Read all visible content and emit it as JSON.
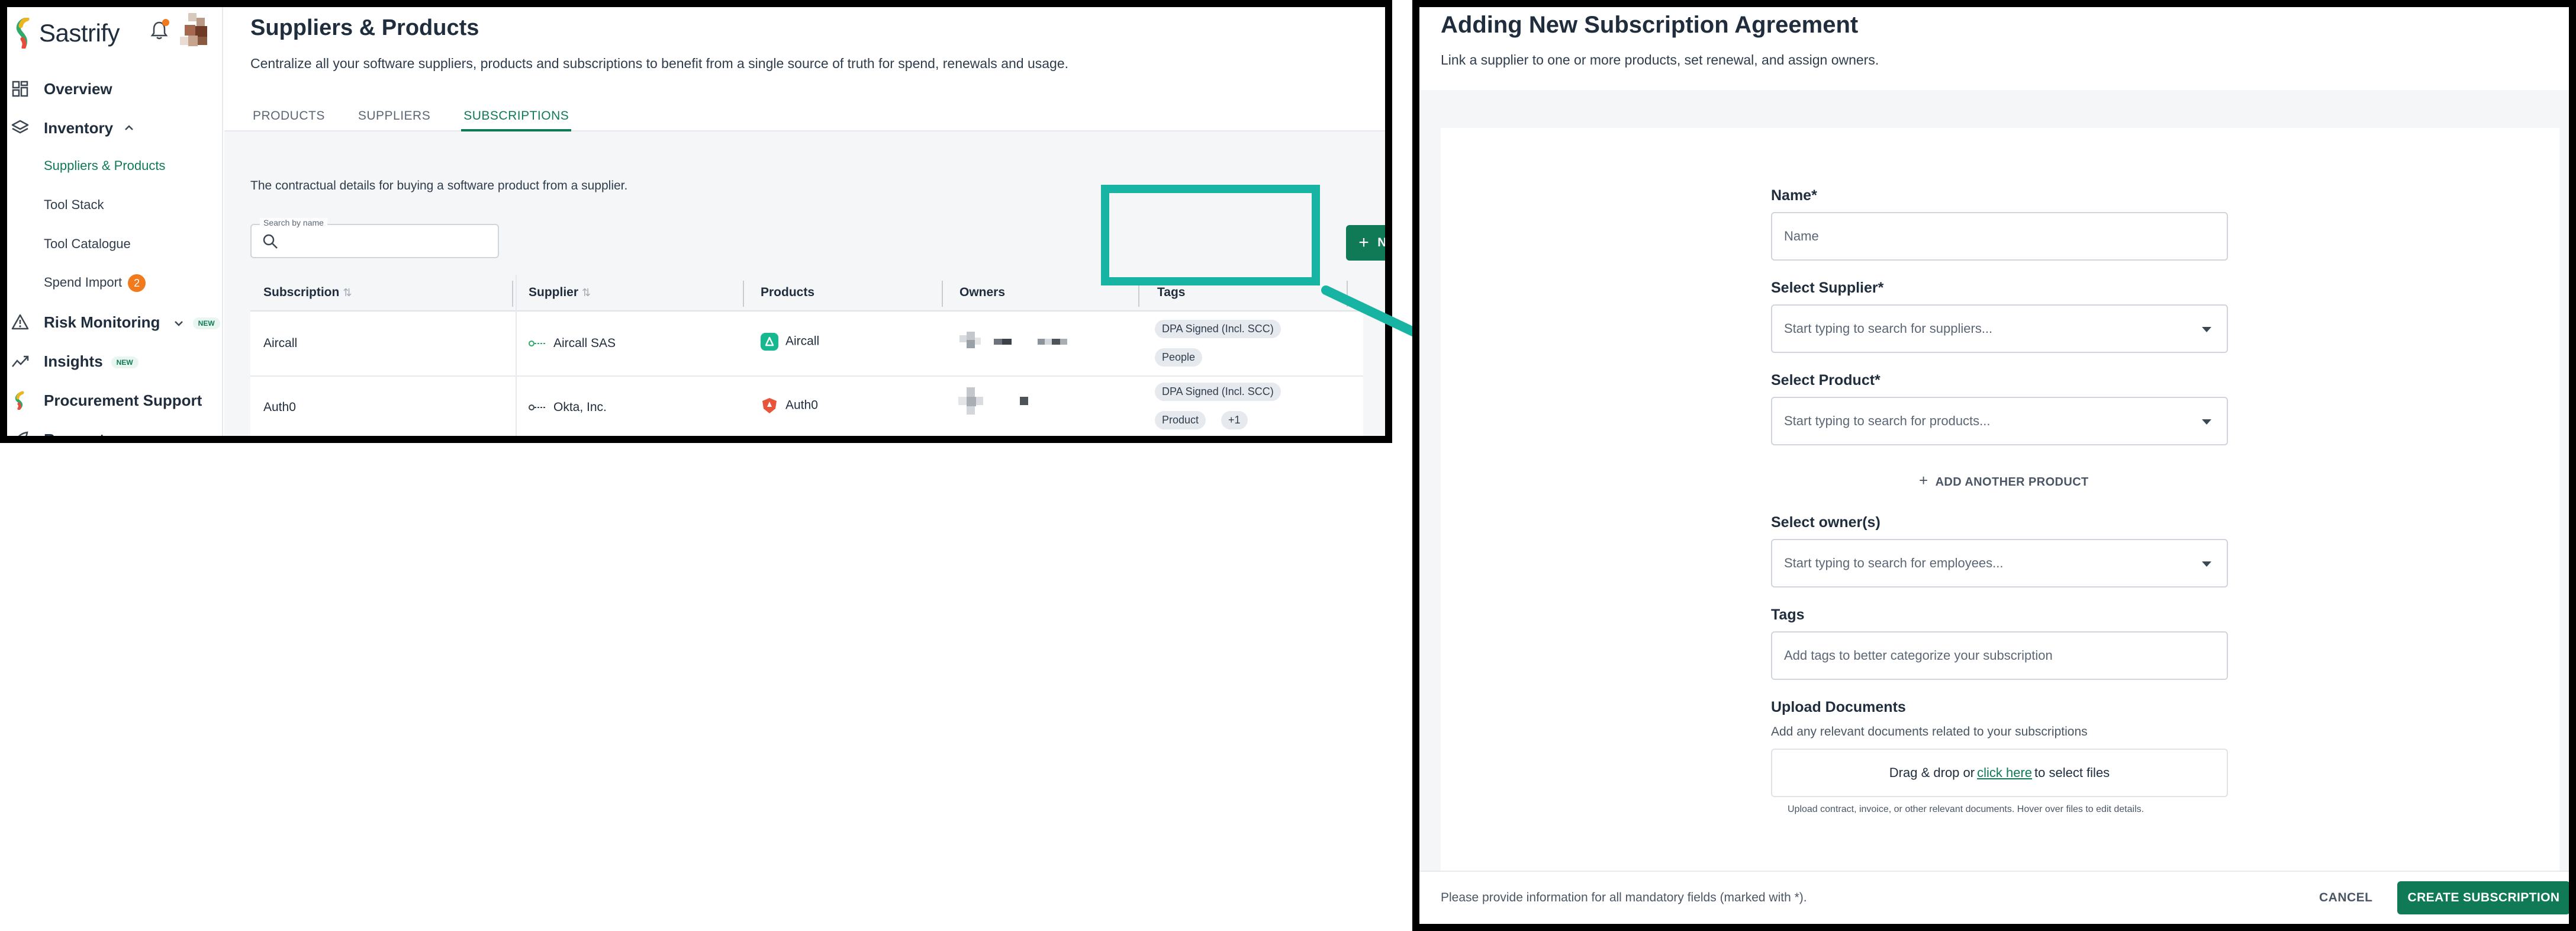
{
  "sidebar": {
    "brand": "Sastrify",
    "items": {
      "overview": "Overview",
      "inventory": "Inventory",
      "suppliers_products": "Suppliers & Products",
      "tool_stack": "Tool Stack",
      "tool_catalogue": "Tool Catalogue",
      "spend_import": "Spend Import",
      "spend_import_count": "2",
      "risk_monitoring": "Risk Monitoring",
      "insights": "Insights",
      "new_badge": "NEW",
      "procurement_support": "Procurement Support",
      "requests": "Requests"
    }
  },
  "main": {
    "title": "Suppliers & Products",
    "subtitle": "Centralize all your software suppliers, products and subscriptions to benefit from a single source of truth for spend, renewals and usage.",
    "tabs": [
      "PRODUCTS",
      "SUPPLIERS",
      "SUBSCRIPTIONS"
    ],
    "description": "The contractual details for buying a software product from a supplier.",
    "search_label": "Search by name",
    "new_subscription_label": "NEW SUBSCRIPTION",
    "table": {
      "headers": [
        "Subscription",
        "Supplier",
        "Products",
        "Owners",
        "Tags"
      ],
      "rows": [
        {
          "subscription": "Aircall",
          "supplier": "Aircall SAS",
          "product": "Aircall",
          "tags": [
            "DPA Signed (Incl. SCC)",
            "People"
          ]
        },
        {
          "subscription": "Auth0",
          "supplier": "Okta, Inc.",
          "product": "Auth0",
          "tags": [
            "DPA Signed (Incl. SCC)",
            "Product",
            "+1"
          ]
        }
      ]
    }
  },
  "form": {
    "title": "Adding New Subscription Agreement",
    "subtitle": "Link a supplier to one or more products, set renewal, and assign owners.",
    "name_label": "Name*",
    "name_placeholder": "Name",
    "supplier_label": "Select Supplier*",
    "supplier_placeholder": "Start typing to search for suppliers...",
    "product_label": "Select Product*",
    "product_placeholder": "Start typing to search for products...",
    "add_product_label": "ADD ANOTHER PRODUCT",
    "owner_label": "Select owner(s)",
    "owner_placeholder": "Start typing to search for employees...",
    "tags_label": "Tags",
    "tags_placeholder": "Add tags to better categorize your subscription",
    "upload_label": "Upload Documents",
    "upload_desc": "Add any relevant documents related to your subscriptions",
    "drop_text_pre": "Drag & drop or",
    "drop_link": "click here",
    "drop_text_post": "to select files",
    "upload_hint": "Upload contract, invoice, or other relevant documents. Hover over files to edit details.",
    "footer_note": "Please provide information for all mandatory fields (marked with *).",
    "cancel_label": "CANCEL",
    "create_label": "CREATE SUBSCRIPTION"
  },
  "colors": {
    "accent": "#0f7a55",
    "highlight": "#17b3a3",
    "badge": "#f07a1c"
  }
}
